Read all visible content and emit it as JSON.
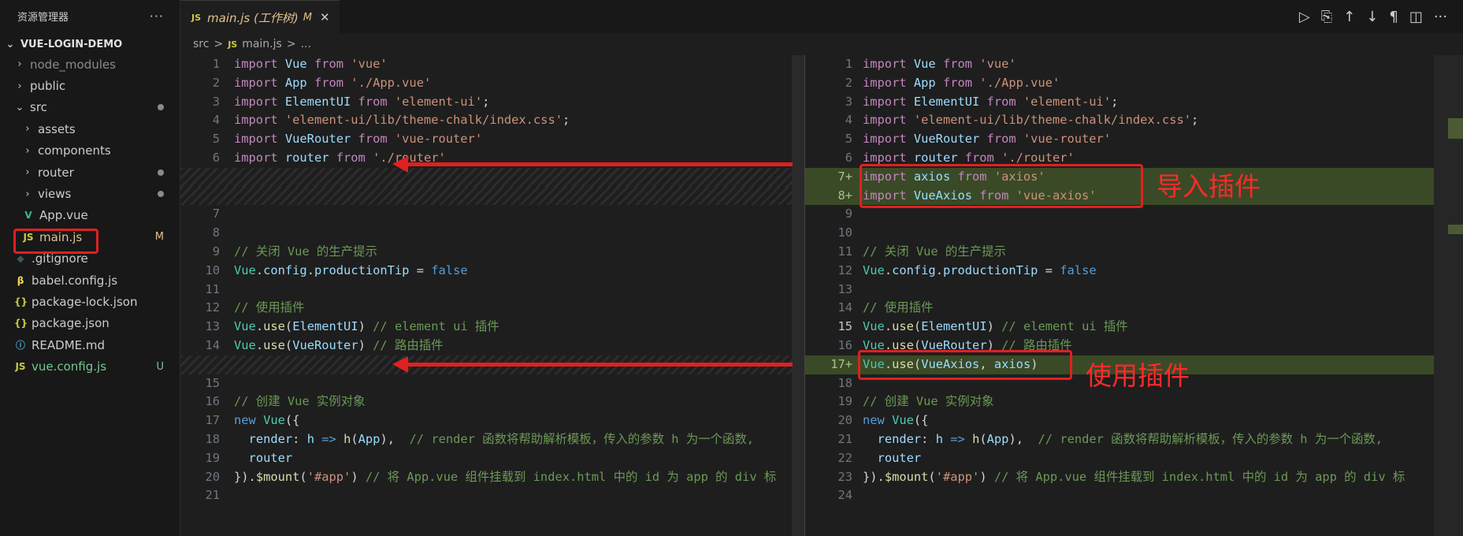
{
  "explorer": {
    "title": "资源管理器",
    "more": "···",
    "root": "VUE-LOGIN-DEMO",
    "items": [
      {
        "label": "node_modules",
        "type": "folder",
        "depth": 1,
        "color": "#8b8b8b"
      },
      {
        "label": "public",
        "type": "folder",
        "depth": 1,
        "color": "#cccccc"
      },
      {
        "label": "src",
        "type": "folder-open",
        "depth": 1,
        "color": "#cccccc",
        "dot": true
      },
      {
        "label": "assets",
        "type": "folder",
        "depth": 2,
        "color": "#cccccc"
      },
      {
        "label": "components",
        "type": "folder",
        "depth": 2,
        "color": "#cccccc"
      },
      {
        "label": "router",
        "type": "folder",
        "depth": 2,
        "color": "#cccccc",
        "dot": true
      },
      {
        "label": "views",
        "type": "folder",
        "depth": 2,
        "color": "#cccccc",
        "dot": true
      },
      {
        "label": "App.vue",
        "type": "file",
        "icon": "V",
        "icon_color": "#41b883",
        "depth": 2,
        "color": "#cccccc"
      },
      {
        "label": "main.js",
        "type": "file",
        "icon": "JS",
        "icon_color": "#cbcb41",
        "depth": 2,
        "color": "#e2c08d",
        "badge": "M",
        "badge_color": "#e2c08d",
        "selected": true
      },
      {
        "label": ".gitignore",
        "type": "file",
        "icon": "◆",
        "icon_color": "#41535b",
        "depth": 1,
        "color": "#cccccc"
      },
      {
        "label": "babel.config.js",
        "type": "file",
        "icon": "β",
        "icon_color": "#f5da55",
        "depth": 1,
        "color": "#cccccc"
      },
      {
        "label": "package-lock.json",
        "type": "file",
        "icon": "{}",
        "icon_color": "#cbcb41",
        "depth": 1,
        "color": "#cccccc"
      },
      {
        "label": "package.json",
        "type": "file",
        "icon": "{}",
        "icon_color": "#cbcb41",
        "depth": 1,
        "color": "#cccccc"
      },
      {
        "label": "README.md",
        "type": "file",
        "icon": "ⓘ",
        "icon_color": "#519aba",
        "depth": 1,
        "color": "#cccccc"
      },
      {
        "label": "vue.config.js",
        "type": "file",
        "icon": "JS",
        "icon_color": "#cbcb41",
        "depth": 1,
        "color": "#73c991",
        "badge": "U",
        "badge_color": "#73c991"
      }
    ]
  },
  "tab": {
    "icon": "JS",
    "label": "main.js (工作树)",
    "modified": "M",
    "close": "✕"
  },
  "breadcrumb": {
    "folder": "src",
    "sep": ">",
    "icon": "JS",
    "file": "main.js",
    "sep2": ">",
    "more": "..."
  },
  "editor_actions": [
    "▷",
    "⎘",
    "↑",
    "↓",
    "¶",
    "◫",
    "···"
  ],
  "left_lines": [
    {
      "n": "1",
      "code": [
        [
          "k",
          "import "
        ],
        [
          "v",
          "Vue "
        ],
        [
          "k",
          "from "
        ],
        [
          "s",
          "'vue'"
        ]
      ]
    },
    {
      "n": "2",
      "code": [
        [
          "k",
          "import "
        ],
        [
          "v",
          "App "
        ],
        [
          "k",
          "from "
        ],
        [
          "s",
          "'./App.vue'"
        ]
      ]
    },
    {
      "n": "3",
      "code": [
        [
          "k",
          "import "
        ],
        [
          "v",
          "ElementUI "
        ],
        [
          "k",
          "from "
        ],
        [
          "s",
          "'element-ui'"
        ],
        [
          "p",
          ";"
        ]
      ]
    },
    {
      "n": "4",
      "code": [
        [
          "k",
          "import "
        ],
        [
          "s",
          "'element-ui/lib/theme-chalk/index.css'"
        ],
        [
          "p",
          ";"
        ]
      ]
    },
    {
      "n": "5",
      "code": [
        [
          "k",
          "import "
        ],
        [
          "v",
          "VueRouter "
        ],
        [
          "k",
          "from "
        ],
        [
          "s",
          "'vue-router'"
        ]
      ]
    },
    {
      "n": "6",
      "code": [
        [
          "k",
          "import "
        ],
        [
          "v",
          "router "
        ],
        [
          "k",
          "from "
        ],
        [
          "s",
          "'./router'"
        ]
      ]
    },
    {
      "n": "",
      "hatch": true,
      "code": []
    },
    {
      "n": "",
      "hatch": true,
      "code": []
    },
    {
      "n": "7",
      "code": []
    },
    {
      "n": "8",
      "code": []
    },
    {
      "n": "9",
      "code": [
        [
          "c",
          "// 关闭 Vue 的生产提示"
        ]
      ]
    },
    {
      "n": "10",
      "code": [
        [
          "t",
          "Vue"
        ],
        [
          "p",
          "."
        ],
        [
          "v",
          "config"
        ],
        [
          "p",
          "."
        ],
        [
          "v",
          "productionTip"
        ],
        [
          "p",
          " = "
        ],
        [
          "kb",
          "false"
        ]
      ]
    },
    {
      "n": "11",
      "code": []
    },
    {
      "n": "12",
      "code": [
        [
          "c",
          "// 使用插件"
        ]
      ]
    },
    {
      "n": "13",
      "code": [
        [
          "t",
          "Vue"
        ],
        [
          "p",
          "."
        ],
        [
          "f",
          "use"
        ],
        [
          "p",
          "("
        ],
        [
          "v",
          "ElementUI"
        ],
        [
          "p",
          ") "
        ],
        [
          "c",
          "// element ui 插件"
        ]
      ]
    },
    {
      "n": "14",
      "code": [
        [
          "t",
          "Vue"
        ],
        [
          "p",
          "."
        ],
        [
          "f",
          "use"
        ],
        [
          "p",
          "("
        ],
        [
          "v",
          "VueRouter"
        ],
        [
          "p",
          ") "
        ],
        [
          "c",
          "// 路由插件"
        ]
      ]
    },
    {
      "n": "",
      "hatch": true,
      "code": []
    },
    {
      "n": "15",
      "code": []
    },
    {
      "n": "16",
      "code": [
        [
          "c",
          "// 创建 Vue 实例对象"
        ]
      ]
    },
    {
      "n": "17",
      "code": [
        [
          "kb",
          "new "
        ],
        [
          "t",
          "Vue"
        ],
        [
          "p",
          "({"
        ]
      ]
    },
    {
      "n": "18",
      "code": [
        [
          "p",
          "  "
        ],
        [
          "v",
          "render"
        ],
        [
          "p",
          ": "
        ],
        [
          "v",
          "h"
        ],
        [
          "kb",
          " => "
        ],
        [
          "f",
          "h"
        ],
        [
          "p",
          "("
        ],
        [
          "v",
          "App"
        ],
        [
          "p",
          "),  "
        ],
        [
          "c",
          "// render 函数将帮助解析模板，传入的参数 h 为一个函数,"
        ]
      ]
    },
    {
      "n": "19",
      "code": [
        [
          "p",
          "  "
        ],
        [
          "v",
          "router"
        ]
      ]
    },
    {
      "n": "20",
      "code": [
        [
          "p",
          "})."
        ],
        [
          "f",
          "$mount"
        ],
        [
          "p",
          "("
        ],
        [
          "s",
          "'#app'"
        ],
        [
          "p",
          ") "
        ],
        [
          "c",
          "// 将 App.vue 组件挂载到 index.html 中的 id 为 app 的 div 标"
        ]
      ]
    },
    {
      "n": "21",
      "code": []
    }
  ],
  "right_lines": [
    {
      "n": "1",
      "code": [
        [
          "k",
          "import "
        ],
        [
          "v",
          "Vue "
        ],
        [
          "k",
          "from "
        ],
        [
          "s",
          "'vue'"
        ]
      ]
    },
    {
      "n": "2",
      "code": [
        [
          "k",
          "import "
        ],
        [
          "v",
          "App "
        ],
        [
          "k",
          "from "
        ],
        [
          "s",
          "'./App.vue'"
        ]
      ]
    },
    {
      "n": "3",
      "code": [
        [
          "k",
          "import "
        ],
        [
          "v",
          "ElementUI "
        ],
        [
          "k",
          "from "
        ],
        [
          "s",
          "'element-ui'"
        ],
        [
          "p",
          ";"
        ]
      ]
    },
    {
      "n": "4",
      "code": [
        [
          "k",
          "import "
        ],
        [
          "s",
          "'element-ui/lib/theme-chalk/index.css'"
        ],
        [
          "p",
          ";"
        ]
      ]
    },
    {
      "n": "5",
      "code": [
        [
          "k",
          "import "
        ],
        [
          "v",
          "VueRouter "
        ],
        [
          "k",
          "from "
        ],
        [
          "s",
          "'vue-router'"
        ]
      ]
    },
    {
      "n": "6",
      "code": [
        [
          "k",
          "import "
        ],
        [
          "v",
          "router "
        ],
        [
          "k",
          "from "
        ],
        [
          "s",
          "'./router'"
        ]
      ]
    },
    {
      "n": "7+",
      "added": true,
      "code": [
        [
          "k",
          "import "
        ],
        [
          "v",
          "axios "
        ],
        [
          "k",
          "from "
        ],
        [
          "s",
          "'axios'"
        ]
      ]
    },
    {
      "n": "8+",
      "added": true,
      "code": [
        [
          "k",
          "import "
        ],
        [
          "v",
          "VueAxios "
        ],
        [
          "k",
          "from "
        ],
        [
          "s",
          "'vue-axios'"
        ]
      ]
    },
    {
      "n": "9",
      "code": []
    },
    {
      "n": "10",
      "code": []
    },
    {
      "n": "11",
      "code": [
        [
          "c",
          "// 关闭 Vue 的生产提示"
        ]
      ]
    },
    {
      "n": "12",
      "code": [
        [
          "t",
          "Vue"
        ],
        [
          "p",
          "."
        ],
        [
          "v",
          "config"
        ],
        [
          "p",
          "."
        ],
        [
          "v",
          "productionTip"
        ],
        [
          "p",
          " = "
        ],
        [
          "kb",
          "false"
        ]
      ]
    },
    {
      "n": "13",
      "code": []
    },
    {
      "n": "14",
      "code": [
        [
          "c",
          "// 使用插件"
        ]
      ]
    },
    {
      "n": "15",
      "cur": true,
      "code": [
        [
          "t",
          "Vue"
        ],
        [
          "p",
          "."
        ],
        [
          "f",
          "use"
        ],
        [
          "p",
          "("
        ],
        [
          "v",
          "ElementUI"
        ],
        [
          "p",
          ") "
        ],
        [
          "c",
          "// element ui 插件"
        ]
      ]
    },
    {
      "n": "16",
      "code": [
        [
          "t",
          "Vue"
        ],
        [
          "p",
          "."
        ],
        [
          "f",
          "use"
        ],
        [
          "p",
          "("
        ],
        [
          "v",
          "VueRouter"
        ],
        [
          "p",
          ") "
        ],
        [
          "c",
          "// 路由插件"
        ]
      ]
    },
    {
      "n": "17+",
      "added": true,
      "code": [
        [
          "t",
          "Vue"
        ],
        [
          "p",
          "."
        ],
        [
          "f",
          "use"
        ],
        [
          "p",
          "("
        ],
        [
          "v",
          "VueAxios"
        ],
        [
          "p",
          ", "
        ],
        [
          "v",
          "axios"
        ],
        [
          "p",
          ")"
        ]
      ]
    },
    {
      "n": "18",
      "code": []
    },
    {
      "n": "19",
      "code": [
        [
          "c",
          "// 创建 Vue 实例对象"
        ]
      ]
    },
    {
      "n": "20",
      "code": [
        [
          "kb",
          "new "
        ],
        [
          "t",
          "Vue"
        ],
        [
          "p",
          "({"
        ]
      ]
    },
    {
      "n": "21",
      "code": [
        [
          "p",
          "  "
        ],
        [
          "v",
          "render"
        ],
        [
          "p",
          ": "
        ],
        [
          "v",
          "h"
        ],
        [
          "kb",
          " => "
        ],
        [
          "f",
          "h"
        ],
        [
          "p",
          "("
        ],
        [
          "v",
          "App"
        ],
        [
          "p",
          "),  "
        ],
        [
          "c",
          "// render 函数将帮助解析模板，传入的参数 h 为一个函数,"
        ]
      ]
    },
    {
      "n": "22",
      "code": [
        [
          "p",
          "  "
        ],
        [
          "v",
          "router"
        ]
      ]
    },
    {
      "n": "23",
      "code": [
        [
          "p",
          "})."
        ],
        [
          "f",
          "$mount"
        ],
        [
          "p",
          "("
        ],
        [
          "s",
          "'#app'"
        ],
        [
          "p",
          ") "
        ],
        [
          "c",
          "// 将 App.vue 组件挂载到 index.html 中的 id 为 app 的 div 标"
        ]
      ]
    },
    {
      "n": "24",
      "code": []
    }
  ],
  "annotations": {
    "import_label": "导入插件",
    "use_label": "使用插件"
  },
  "colors": {
    "accent_red": "#e02020",
    "added_bg": "#3a4a26"
  }
}
